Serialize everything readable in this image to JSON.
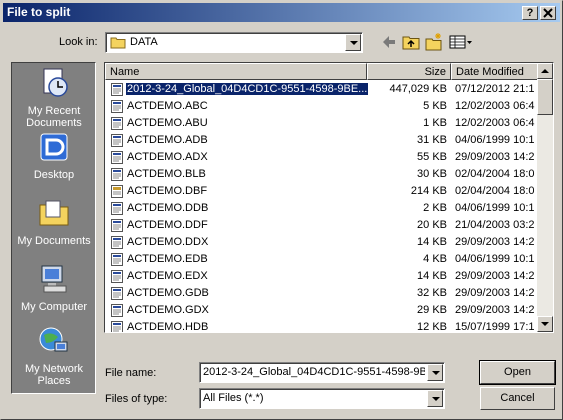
{
  "window": {
    "title": "File to split",
    "help_btn": "?",
    "close_btn": "X"
  },
  "lookin": {
    "label": "Look in:",
    "value": "DATA"
  },
  "places": [
    {
      "label": "My Recent Documents"
    },
    {
      "label": "Desktop"
    },
    {
      "label": "My Documents"
    },
    {
      "label": "My Computer"
    },
    {
      "label": "My Network Places"
    }
  ],
  "columns": {
    "name": "Name",
    "size": "Size",
    "date": "Date Modified"
  },
  "files": [
    {
      "name": "2012-3-24_Global_04D4CD1C-9551-4598-9BE...",
      "size": "447,029 KB",
      "date": "07/12/2012 21:1"
    },
    {
      "name": "ACTDEMO.ABC",
      "size": "5 KB",
      "date": "12/02/2003 06:4"
    },
    {
      "name": "ACTDEMO.ABU",
      "size": "1 KB",
      "date": "12/02/2003 06:4"
    },
    {
      "name": "ACTDEMO.ADB",
      "size": "31 KB",
      "date": "04/06/1999 10:1"
    },
    {
      "name": "ACTDEMO.ADX",
      "size": "55 KB",
      "date": "29/09/2003 14:2"
    },
    {
      "name": "ACTDEMO.BLB",
      "size": "30 KB",
      "date": "02/04/2004 18:0"
    },
    {
      "name": "ACTDEMO.DBF",
      "size": "214 KB",
      "date": "02/04/2004 18:0"
    },
    {
      "name": "ACTDEMO.DDB",
      "size": "2 KB",
      "date": "04/06/1999 10:1"
    },
    {
      "name": "ACTDEMO.DDF",
      "size": "20 KB",
      "date": "21/04/2003 03:2"
    },
    {
      "name": "ACTDEMO.DDX",
      "size": "14 KB",
      "date": "29/09/2003 14:2"
    },
    {
      "name": "ACTDEMO.EDB",
      "size": "4 KB",
      "date": "04/06/1999 10:1"
    },
    {
      "name": "ACTDEMO.EDX",
      "size": "14 KB",
      "date": "29/09/2003 14:2"
    },
    {
      "name": "ACTDEMO.GDB",
      "size": "32 KB",
      "date": "29/09/2003 14:2"
    },
    {
      "name": "ACTDEMO.GDX",
      "size": "29 KB",
      "date": "29/09/2003 14:2"
    },
    {
      "name": "ACTDEMO.HDB",
      "size": "12 KB",
      "date": "15/07/1999 17:1"
    }
  ],
  "filename": {
    "label": "File name:",
    "value": "2012-3-24_Global_04D4CD1C-9551-4598-9BE"
  },
  "filetype": {
    "label": "Files of type:",
    "value": "All Files (*.*)"
  },
  "buttons": {
    "open": "Open",
    "cancel": "Cancel"
  },
  "colors": {
    "titlebar_start": "#0a246a",
    "titlebar_end": "#a6caf0",
    "selection": "#0a246a",
    "face": "#d4d0c8"
  }
}
